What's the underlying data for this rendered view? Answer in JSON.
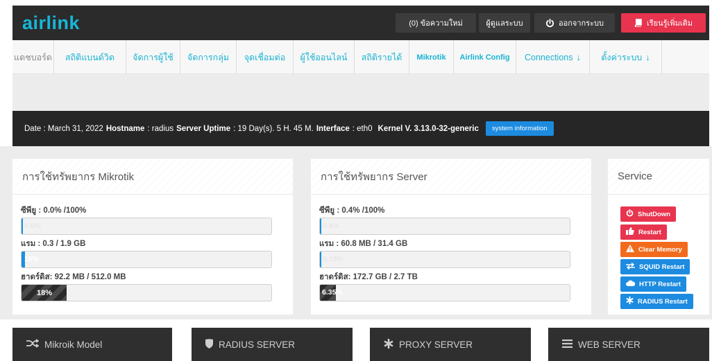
{
  "header": {
    "brand": "airlink",
    "messages_label": "(0) ข้อความใหม่",
    "admin_label": "ผู้ดูแลระบบ",
    "logout_label": "ออกจากระบบ",
    "learn_label": "เรียนรู้เพิ่มเติม"
  },
  "nav": {
    "items": [
      {
        "label": "แดชบอร์ด"
      },
      {
        "label": "สถิติแบนด์วิด"
      },
      {
        "label": "จัดการผู้ใช้"
      },
      {
        "label": "จัดการกลุ่ม"
      },
      {
        "label": "จุดเชื่อมต่อ"
      },
      {
        "label": "ผู้ใช้ออนไลน์"
      },
      {
        "label": "สถิติรายได้"
      },
      {
        "label": "Mikrotik"
      },
      {
        "label": "Airlink Config"
      },
      {
        "label": "Connections"
      },
      {
        "label": "ตั้งค่าระบบ"
      }
    ]
  },
  "info": {
    "date_label": "Date :",
    "date_value": "March 31, 2022",
    "hostname_label": "Hostname",
    "hostname_value": ": radius",
    "uptime_label": "Server Uptime",
    "uptime_value": ": 19 Day(s). 5 H. 45 M.",
    "interface_label": "Interface",
    "interface_value": ": eth0",
    "kernel": "Kernel V. 3.13.0-32-generic",
    "sysinfo_button": "system information"
  },
  "mikrotik": {
    "title": "การใช้ทรัพยากร Mikrotik",
    "cpu_label": "ซีพียู : 0.0% /100%",
    "cpu_text": "0.0%",
    "cpu_fraction": 0.0,
    "ram_label": "แรม : 0.3 / 1.9 GB",
    "ram_text": "15%",
    "ram_fraction": 0.015,
    "disk_label": "ฮาดร์ดิส: 92.2 MB / 512.0 MB",
    "disk_text": "18%",
    "disk_fraction": 0.18
  },
  "server": {
    "title": "การใช้ทรัพยากร Server",
    "cpu_label": "ซีพียู : 0.4% /100%",
    "cpu_text": "0.4%",
    "cpu_fraction": 0.004,
    "ram_label": "แรม : 60.8 MB / 31.4 GB",
    "ram_text": "0.19%",
    "ram_fraction": 0.0019,
    "disk_label": "ฮาดร์ดิส: 172.7 GB / 2.7 TB",
    "disk_text": "6.35%",
    "disk_fraction": 0.0635
  },
  "service": {
    "title": "Service",
    "buttons": [
      {
        "label": "ShutDown",
        "icon": "power-icon",
        "color": "#e8344e"
      },
      {
        "label": "Restart",
        "icon": "thumbs-up-icon",
        "color": "#e8344e"
      },
      {
        "label": "Clear Memory",
        "icon": "warning-icon",
        "color": "#f26b1d"
      },
      {
        "label": "SQUID Restart",
        "icon": "exchange-icon",
        "color": "#1c8be0"
      },
      {
        "label": "HTTP Restart",
        "icon": "cloud-icon",
        "color": "#1c8be0"
      },
      {
        "label": "RADIUS Restart",
        "icon": "asterisk-icon",
        "color": "#1c8be0"
      }
    ]
  },
  "bottom": {
    "boxes": [
      {
        "label": "Mikroik Model",
        "icon": "shuffle-icon"
      },
      {
        "label": "RADIUS SERVER",
        "icon": "shield-icon"
      },
      {
        "label": "PROXY SERVER",
        "icon": "asterisk-icon"
      },
      {
        "label": "WEB SERVER",
        "icon": "list-icon"
      }
    ]
  },
  "colors": {
    "accent": "#19b3d3",
    "topbar": "#2b2b2b",
    "danger": "#e8344e",
    "warning": "#f26b1d",
    "info": "#1c8be0"
  }
}
